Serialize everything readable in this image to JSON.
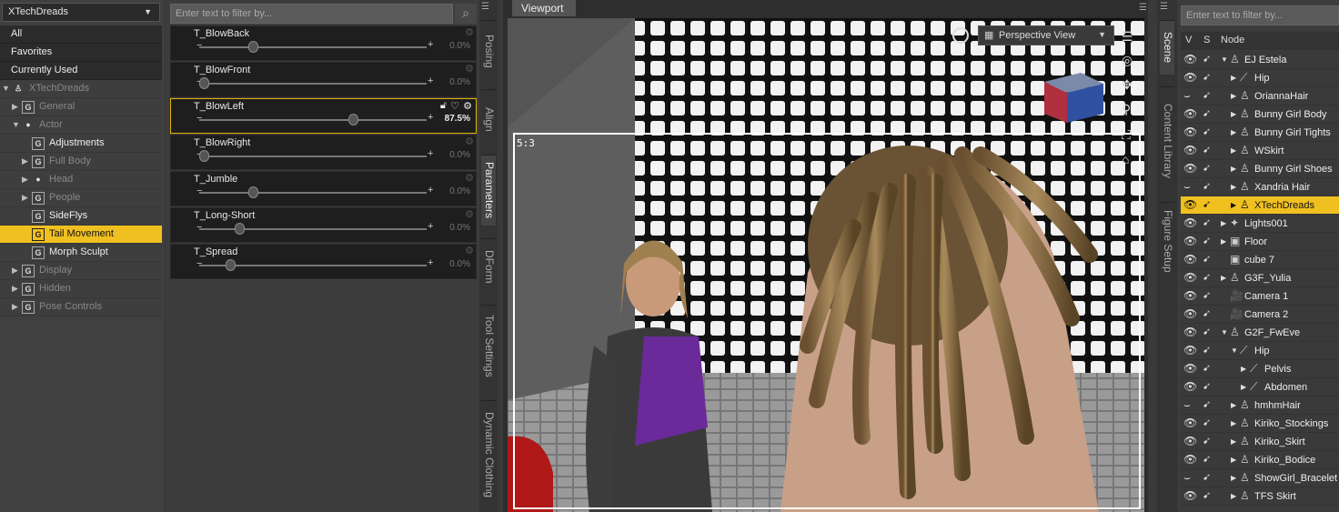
{
  "left_panel": {
    "figure_select": "XTechDreads",
    "flat_items": [
      "All",
      "Favorites",
      "Currently Used"
    ],
    "tree": [
      {
        "label": "XTechDreads",
        "icon": "figure-icon",
        "expander": "▼",
        "level": 0,
        "bright": false
      },
      {
        "label": "General",
        "icon": "group-icon",
        "expander": "▶",
        "level": 1,
        "bright": false
      },
      {
        "label": "Actor",
        "icon": "person-icon",
        "expander": "▼",
        "level": 1,
        "bright": false
      },
      {
        "label": "Adjustments",
        "icon": "group-icon",
        "expander": "",
        "level": 2,
        "bright": true
      },
      {
        "label": "Full Body",
        "icon": "group-icon",
        "expander": "▶",
        "level": 2,
        "bright": false
      },
      {
        "label": "Head",
        "icon": "person-icon",
        "expander": "▶",
        "level": 2,
        "bright": false
      },
      {
        "label": "People",
        "icon": "group-icon",
        "expander": "▶",
        "level": 2,
        "bright": false
      },
      {
        "label": "SideFlys",
        "icon": "group-icon",
        "expander": "",
        "level": 2,
        "bright": true
      },
      {
        "label": "Tail Movement",
        "icon": "group-icon",
        "expander": "",
        "level": 2,
        "bright": true,
        "selected": true
      },
      {
        "label": "Morph Sculpt",
        "icon": "group-icon",
        "expander": "",
        "level": 2,
        "bright": true
      },
      {
        "label": "Display",
        "icon": "group-icon",
        "expander": "▶",
        "level": 1,
        "bright": false
      },
      {
        "label": "Hidden",
        "icon": "group-icon",
        "expander": "▶",
        "level": 1,
        "bright": false
      },
      {
        "label": "Pose Controls",
        "icon": "group-icon",
        "expander": "▶",
        "level": 1,
        "bright": false
      }
    ]
  },
  "params": {
    "filter_placeholder": "Enter text to filter by...",
    "items": [
      {
        "name": "T_BlowBack",
        "value": "0.0%",
        "fraction": 0.22
      },
      {
        "name": "T_BlowFront",
        "value": "0.0%",
        "fraction": 0.0
      },
      {
        "name": "T_BlowLeft",
        "value": "87.5%",
        "fraction": 0.67,
        "active": true
      },
      {
        "name": "T_BlowRight",
        "value": "0.0%",
        "fraction": 0.0
      },
      {
        "name": "T_Jumble",
        "value": "0.0%",
        "fraction": 0.22
      },
      {
        "name": "T_Long-Short",
        "value": "0.0%",
        "fraction": 0.16
      },
      {
        "name": "T_Spread",
        "value": "0.0%",
        "fraction": 0.12
      }
    ]
  },
  "side_tabs": [
    "Posing",
    "Align",
    "Parameters",
    "DForm",
    "Tool Settings",
    "Dynamic Clothing"
  ],
  "viewport": {
    "tab": "Viewport",
    "camera": "Perspective View",
    "aspect": "5:3"
  },
  "right_tabs": [
    "Scene",
    "Content Library",
    "Figure Setup"
  ],
  "scene": {
    "filter_placeholder": "Enter text to filter by...",
    "headers": {
      "v": "V",
      "s": "S",
      "node": "Node"
    },
    "nodes": [
      {
        "label": "EJ Estela",
        "icon": "figure-icon",
        "level": 0,
        "expander": "▼"
      },
      {
        "label": "Hip",
        "icon": "bone-icon",
        "level": 1,
        "expander": "▶"
      },
      {
        "label": "OriannaHair",
        "icon": "figure-icon",
        "level": 1,
        "expander": "▶",
        "eye": "closed"
      },
      {
        "label": "Bunny Girl Body",
        "icon": "figure-icon",
        "level": 1,
        "expander": "▶"
      },
      {
        "label": "Bunny Girl Tights",
        "icon": "figure-icon",
        "level": 1,
        "expander": "▶"
      },
      {
        "label": "WSkirt",
        "icon": "figure-icon",
        "level": 1,
        "expander": "▶"
      },
      {
        "label": "Bunny Girl Shoes",
        "icon": "figure-icon",
        "level": 1,
        "expander": "▶"
      },
      {
        "label": "Xandria Hair",
        "icon": "figure-icon",
        "level": 1,
        "expander": "▶",
        "eye": "closed"
      },
      {
        "label": "XTechDreads",
        "icon": "figure-icon",
        "level": 1,
        "expander": "▶",
        "selected": true
      },
      {
        "label": "Lights001",
        "icon": "light-icon",
        "level": 0,
        "expander": "▶"
      },
      {
        "label": "Floor",
        "icon": "cube-icon",
        "level": 0,
        "expander": "▶"
      },
      {
        "label": "cube 7",
        "icon": "cube-icon",
        "level": 0,
        "expander": ""
      },
      {
        "label": "G3F_Yulia",
        "icon": "figure-icon",
        "level": 0,
        "expander": "▶"
      },
      {
        "label": "Camera 1",
        "icon": "camera-icon",
        "level": 0,
        "expander": ""
      },
      {
        "label": "Camera 2",
        "icon": "camera-icon",
        "level": 0,
        "expander": ""
      },
      {
        "label": "G2F_FwEve",
        "icon": "figure-icon",
        "level": 0,
        "expander": "▼"
      },
      {
        "label": "Hip",
        "icon": "bone-icon",
        "level": 1,
        "expander": "▼"
      },
      {
        "label": "Pelvis",
        "icon": "bone-icon",
        "level": 2,
        "expander": "▶"
      },
      {
        "label": "Abdomen",
        "icon": "bone-icon",
        "level": 2,
        "expander": "▶"
      },
      {
        "label": "hmhmHair",
        "icon": "figure-icon",
        "level": 1,
        "expander": "▶",
        "eye": "closed"
      },
      {
        "label": "Kiriko_Stockings",
        "icon": "figure-icon",
        "level": 1,
        "expander": "▶"
      },
      {
        "label": "Kiriko_Skirt",
        "icon": "figure-icon",
        "level": 1,
        "expander": "▶"
      },
      {
        "label": "Kiriko_Bodice",
        "icon": "figure-icon",
        "level": 1,
        "expander": "▶"
      },
      {
        "label": "ShowGirl_Bracelet",
        "icon": "figure-icon",
        "level": 1,
        "expander": "▶",
        "eye": "closed"
      },
      {
        "label": "TFS Skirt",
        "icon": "figure-icon",
        "level": 1,
        "expander": "▶"
      }
    ]
  }
}
